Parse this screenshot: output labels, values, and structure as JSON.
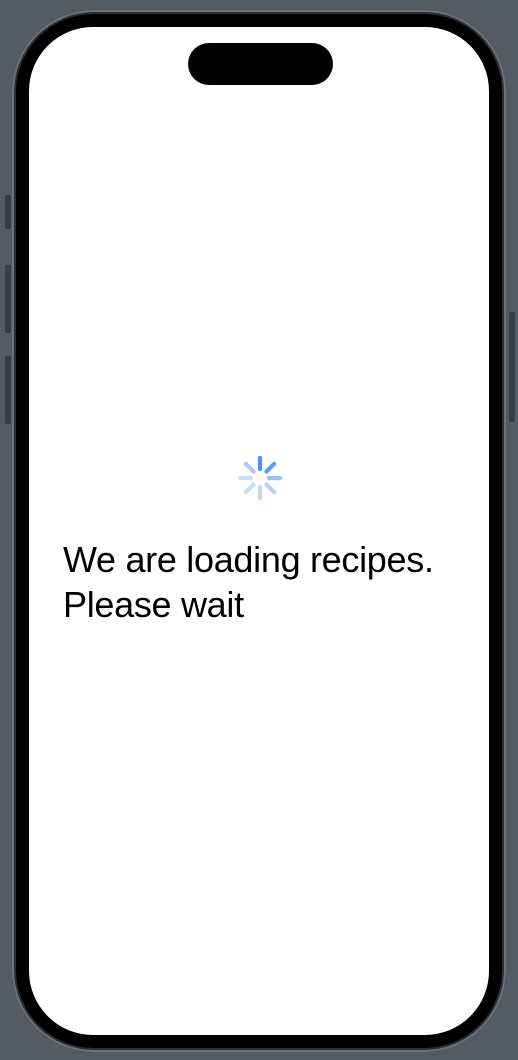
{
  "loading": {
    "message": "We are loading recipes. Please wait"
  },
  "icons": {
    "spinner": "activity-spinner-icon"
  },
  "colors": {
    "spinner": "#4a8af4",
    "background": "#ffffff",
    "text": "#000000"
  }
}
